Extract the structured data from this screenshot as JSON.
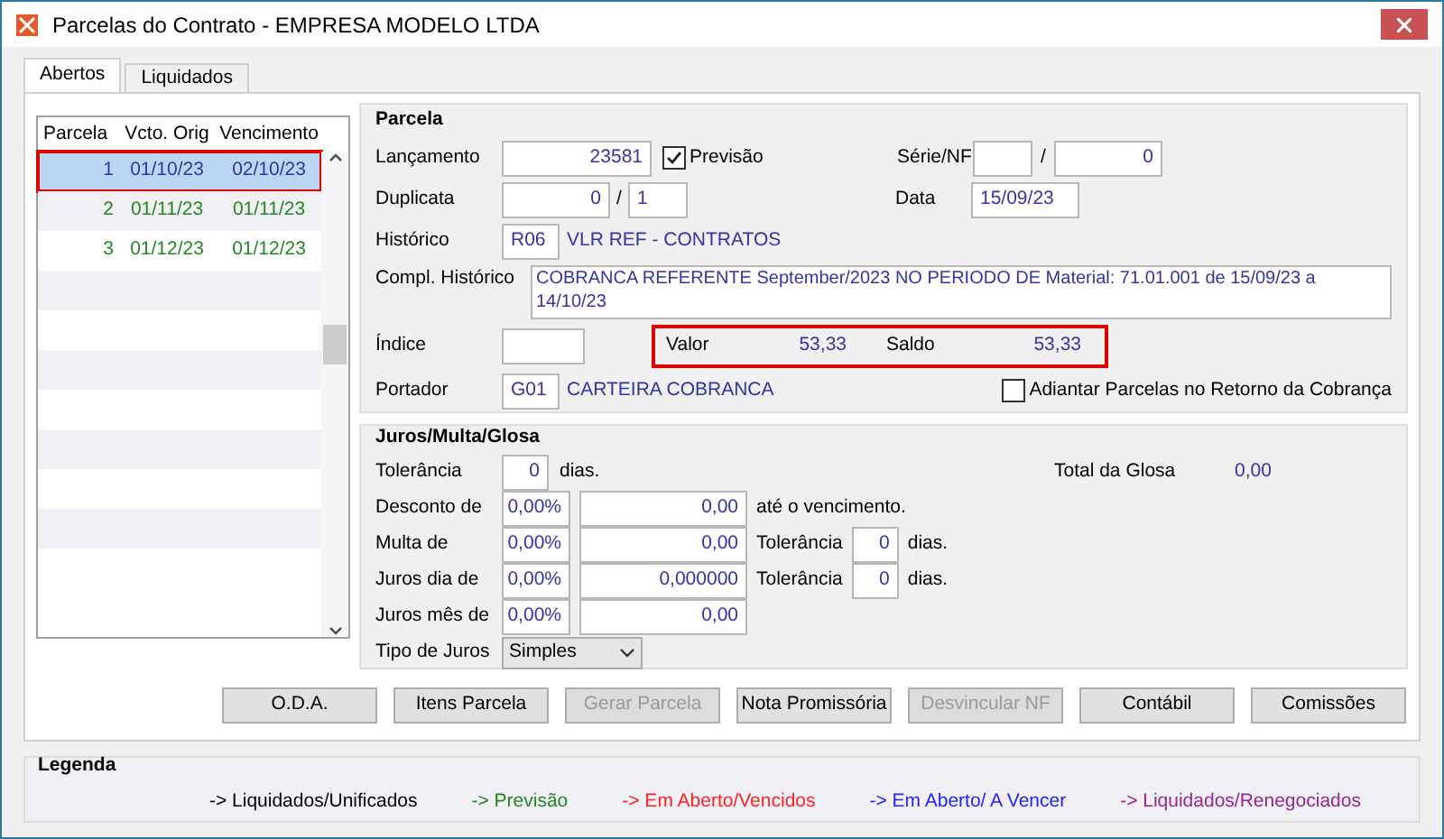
{
  "window": {
    "title": "Parcelas do Contrato - EMPRESA MODELO LTDA"
  },
  "tabs": [
    {
      "label": "Abertos",
      "selected": true
    },
    {
      "label": "Liquidados",
      "selected": false
    }
  ],
  "table": {
    "columns": [
      "Parcela",
      "Vcto. Orig",
      "Vencimento"
    ],
    "rows": [
      {
        "cells": [
          "1",
          "01/10/23",
          "02/10/23"
        ],
        "selected": true,
        "outlined": true,
        "color": "#3333aa"
      },
      {
        "cells": [
          "2",
          "01/11/23",
          "01/11/23"
        ],
        "selected": false,
        "outlined": false,
        "color": "#228822"
      },
      {
        "cells": [
          "3",
          "01/12/23",
          "01/12/23"
        ],
        "selected": false,
        "outlined": false,
        "color": "#228822"
      }
    ]
  },
  "parcela": {
    "title": "Parcela",
    "lancamento": {
      "label": "Lançamento",
      "value": "23581"
    },
    "previsao": {
      "label": "Previsão",
      "checked": true
    },
    "serie_nf": {
      "label": "Série/NF",
      "separator": "/",
      "number": "0"
    },
    "duplicata": {
      "label": "Duplicata",
      "value": "0",
      "separator": "/",
      "total": "1"
    },
    "data": {
      "label": "Data",
      "value": "15/09/23"
    },
    "historico": {
      "label": "Histórico",
      "code": "R06",
      "description": "VLR REF - CONTRATOS"
    },
    "compl_historico": {
      "label": "Compl. Histórico",
      "value": "COBRANCA REFERENTE September/2023 NO PERIODO DE Material: 71.01.001 de 15/09/23 a 14/10/23"
    },
    "indice": {
      "label": "Índice"
    },
    "totals": {
      "outlined": true,
      "valor_label": "Valor",
      "valor": "53,33",
      "saldo_label": "Saldo",
      "saldo": "53,33"
    },
    "portador": {
      "label": "Portador",
      "code": "G01",
      "description": "CARTEIRA COBRANCA"
    },
    "adiantar": {
      "label": "Adiantar Parcelas no Retorno da Cobrança",
      "checked": false
    }
  },
  "juros": {
    "title": "Juros/Multa/Glosa",
    "tolerancia": {
      "label": "Tolerância",
      "value": "0",
      "unit": "dias."
    },
    "total_glosa": {
      "label": "Total da Glosa",
      "value": "0,00"
    },
    "rows": [
      {
        "label": "Desconto de",
        "percent": "0,00%",
        "amount": "0,00",
        "suffix": "até o vencimento."
      },
      {
        "label": "Multa de",
        "percent": "0,00%",
        "amount": "0,00",
        "tol_label": "Tolerância",
        "tol": "0",
        "unit": "dias."
      },
      {
        "label": "Juros dia de",
        "percent": "0,00%",
        "amount": "0,000000",
        "tol_label": "Tolerância",
        "tol": "0",
        "unit": "dias."
      },
      {
        "label": "Juros mês de",
        "percent": "0,00%",
        "amount": "0,00"
      }
    ],
    "tipo": {
      "label": "Tipo de Juros",
      "value": "Simples"
    }
  },
  "buttons": [
    {
      "label": "O.D.A.",
      "disabled": false
    },
    {
      "label": "Itens Parcela",
      "disabled": false
    },
    {
      "label": "Gerar Parcela",
      "disabled": true
    },
    {
      "label": "Nota Promissória",
      "disabled": false
    },
    {
      "label": "Desvincular NF",
      "disabled": true
    },
    {
      "label": "Contábil",
      "disabled": false
    },
    {
      "label": "Comissões",
      "disabled": false
    }
  ],
  "legend": {
    "title": "Legenda",
    "items": [
      {
        "label": "-> Liquidados/Unificados",
        "color": "#000000"
      },
      {
        "label": "-> Previsão",
        "color": "#228822"
      },
      {
        "label": "-> Em Aberto/Vencidos",
        "color": "#ff2222"
      },
      {
        "label": "-> Em Aberto/ A Vencer",
        "color": "#2222ff"
      },
      {
        "label": "-> Liquidados/Renegociados",
        "color": "#992299"
      }
    ]
  }
}
